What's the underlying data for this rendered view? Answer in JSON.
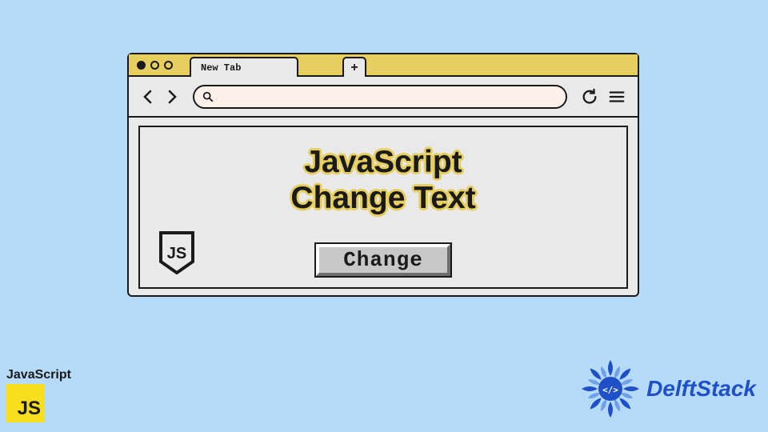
{
  "browser": {
    "tab_label": "New Tab",
    "new_tab_glyph": "+",
    "back_icon": "chevron-left",
    "forward_icon": "chevron-right",
    "refresh_icon": "refresh",
    "menu_icon": "hamburger",
    "search_placeholder": ""
  },
  "content": {
    "headline_line1": "JavaScript",
    "headline_line2": "Change Text",
    "button_label": "Change",
    "js_badge_text": "JS"
  },
  "footer": {
    "js_logo_label": "JavaScript",
    "js_square_text": "JS",
    "delft_label": "DelftStack"
  },
  "colors": {
    "page_bg": "#b5dbf9",
    "accent": "#e6ce5f",
    "brand_blue": "#2050c8",
    "js_yellow": "#f7df1e"
  }
}
